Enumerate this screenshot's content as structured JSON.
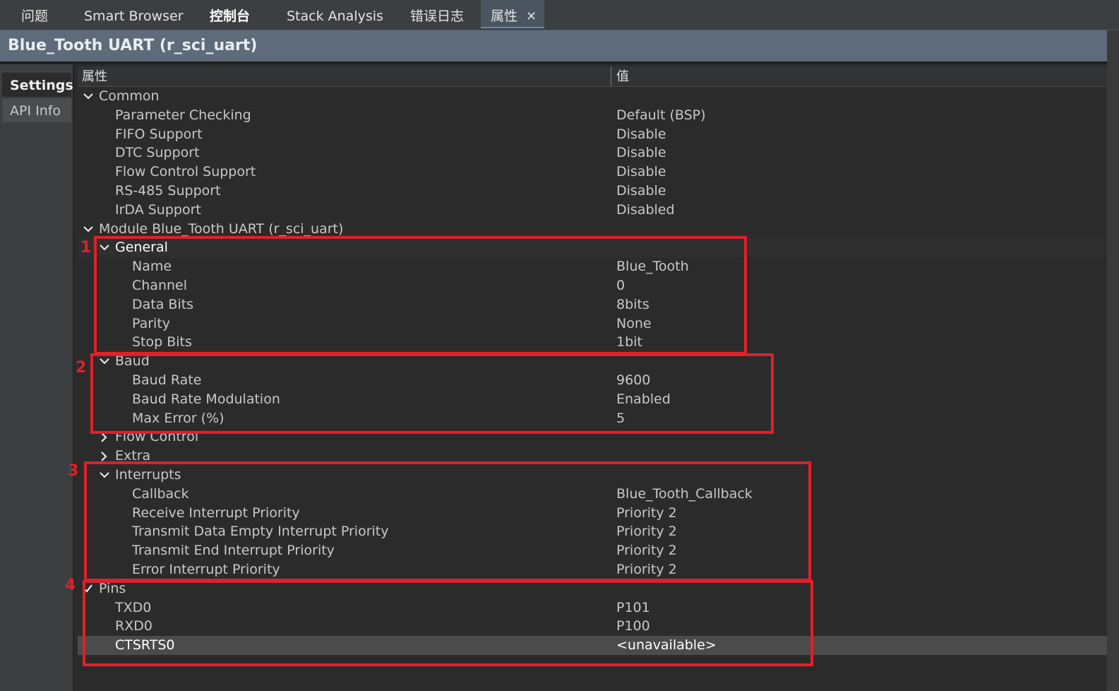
{
  "tabs": [
    {
      "label": "问题"
    },
    {
      "label": "Smart Browser"
    },
    {
      "label": "控制台"
    },
    {
      "label": "Stack Analysis"
    },
    {
      "label": "错误日志"
    },
    {
      "label": "属性"
    }
  ],
  "tab_close_glyph": "✕",
  "window_title": "Blue_Tooth UART (r_sci_uart)",
  "side_tabs": {
    "settings": "Settings",
    "api_info": "API Info"
  },
  "table": {
    "header_property": "属性",
    "header_value": "值",
    "rows": [
      {
        "label": "Common",
        "value": ""
      },
      {
        "label": "Parameter Checking",
        "value": "Default (BSP)"
      },
      {
        "label": "FIFO Support",
        "value": "Disable"
      },
      {
        "label": "DTC Support",
        "value": "Disable"
      },
      {
        "label": "Flow Control Support",
        "value": "Disable"
      },
      {
        "label": "RS-485 Support",
        "value": "Disable"
      },
      {
        "label": "IrDA Support",
        "value": "Disabled"
      },
      {
        "label": "Module Blue_Tooth UART (r_sci_uart)",
        "value": ""
      },
      {
        "label": "General",
        "value": ""
      },
      {
        "label": "Name",
        "value": "Blue_Tooth"
      },
      {
        "label": "Channel",
        "value": "0"
      },
      {
        "label": "Data Bits",
        "value": "8bits"
      },
      {
        "label": "Parity",
        "value": "None"
      },
      {
        "label": "Stop Bits",
        "value": "1bit"
      },
      {
        "label": "Baud",
        "value": ""
      },
      {
        "label": "Baud Rate",
        "value": "9600"
      },
      {
        "label": "Baud Rate Modulation",
        "value": "Enabled"
      },
      {
        "label": "Max Error (%)",
        "value": "5"
      },
      {
        "label": "Flow Control",
        "value": ""
      },
      {
        "label": "Extra",
        "value": ""
      },
      {
        "label": "Interrupts",
        "value": ""
      },
      {
        "label": "Callback",
        "value": "Blue_Tooth_Callback"
      },
      {
        "label": "Receive Interrupt Priority",
        "value": "Priority 2"
      },
      {
        "label": "Transmit Data Empty Interrupt Priority",
        "value": "Priority 2"
      },
      {
        "label": "Transmit End Interrupt Priority",
        "value": "Priority 2"
      },
      {
        "label": "Error Interrupt Priority",
        "value": "Priority 2"
      },
      {
        "label": "Pins",
        "value": ""
      },
      {
        "label": "TXD0",
        "value": "P101"
      },
      {
        "label": "RXD0",
        "value": "P100"
      },
      {
        "label": "CTSRTS0",
        "value": "<unavailable>"
      }
    ]
  },
  "annotations": [
    "1",
    "2",
    "3",
    "4"
  ],
  "colors": {
    "annotation": "#e0202a",
    "accent": "#5a8fd6"
  },
  "icons": {
    "expanded": "chevron-down-icon",
    "collapsed": "chevron-right-icon",
    "checked": "check-icon",
    "close": "close-icon"
  }
}
